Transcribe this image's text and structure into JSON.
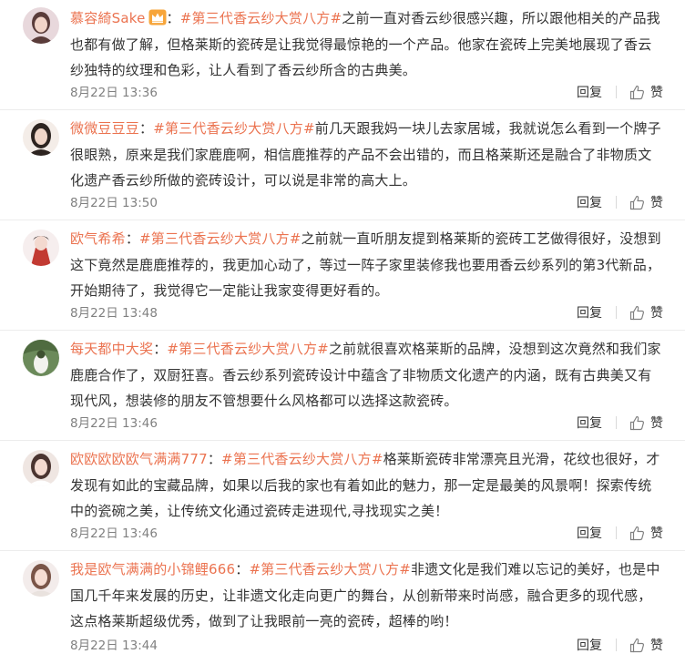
{
  "comments": [
    {
      "user": "慕容綺Sake",
      "has_badge": true,
      "tag": "#第三代香云纱大赏八方#",
      "text": "之前一直对香云纱很感兴趣，所以跟他相关的产品我也都有做了解，但格莱斯的瓷砖是让我觉得最惊艳的一个产品。他家在瓷砖上完美地展现了香云纱独特的纹理和色彩，让人看到了香云纱所含的古典美。",
      "time": "8月22日 13:36",
      "reply_label": "回复",
      "like_label": "赞",
      "avatar_colors": [
        "#e8d8dc",
        "#5a3c3a",
        "#f2d4c8"
      ]
    },
    {
      "user": "微微豆豆豆",
      "has_badge": false,
      "tag": "#第三代香云纱大赏八方#",
      "text": "前几天跟我妈一块儿去家居城，我就说怎么看到一个牌子很眼熟，原来是我们家鹿鹿啊，相信鹿推荐的产品不会出错的，而且格莱斯还是融合了非物质文化遗产香云纱所做的瓷砖设计，可以说是非常的高大上。",
      "time": "8月22日 13:50",
      "reply_label": "回复",
      "like_label": "赞",
      "avatar_colors": [
        "#f4ede8",
        "#2d2420",
        "#f0d6c8"
      ]
    },
    {
      "user": "欧气希希",
      "has_badge": false,
      "tag": "#第三代香云纱大赏八方#",
      "text": "之前就一直听朋友提到格莱斯的瓷砖工艺做得很好，没想到这下竟然是鹿鹿推荐的，我更加心动了，等过一阵子家里装修我也要用香云纱系列的第3代新品，开始期待了，我觉得它一定能让我家变得更好看的。",
      "time": "8月22日 13:48",
      "reply_label": "回复",
      "like_label": "赞",
      "avatar_colors": [
        "#f6eeee",
        "#c23a32",
        "#f3d9cf"
      ]
    },
    {
      "user": "每天都中大奖",
      "has_badge": false,
      "tag": "#第三代香云纱大赏八方#",
      "text": "之前就很喜欢格莱斯的品牌，没想到这次竟然和我们家鹿鹿合作了，双厨狂喜。香云纱系列瓷砖设计中蕴含了非物质文化遗产的内涵，既有古典美又有现代风，想装修的朋友不管想要什么风格都可以选择这款瓷砖。",
      "time": "8月22日 13:46",
      "reply_label": "回复",
      "like_label": "赞",
      "avatar_colors": [
        "#6b8a5a",
        "#f2f2ee",
        "#3e5030"
      ]
    },
    {
      "user": "欧欧欧欧欧气满满777",
      "has_badge": false,
      "tag": "#第三代香云纱大赏八方#",
      "text": "格莱斯瓷砖非常漂亮且光滑，花纹也很好，才发现有如此的宝藏品牌，如果以后我的家也有着如此的魅力，那一定是最美的风景啊！探索传统中的瓷碗之美，让传统文化通过瓷砖走进现代,寻找现实之美！",
      "time": "8月22日 13:46",
      "reply_label": "回复",
      "like_label": "赞",
      "avatar_colors": [
        "#efe6e2",
        "#4a3430",
        "#f4dad0"
      ]
    },
    {
      "user": "我是欧气满满的小锦鲤666",
      "has_badge": false,
      "tag": "#第三代香云纱大赏八方#",
      "text": "非遗文化是我们难以忘记的美好，也是中国几千年来发展的历史，让非遗文化走向更广的舞台，从创新带来时尚感，融合更多的现代感，这点格莱斯超级优秀，做到了让我眼前一亮的瓷砖，超棒的哟！",
      "time": "8月22日 13:44",
      "reply_label": "回复",
      "like_label": "赞",
      "avatar_colors": [
        "#f3eceb",
        "#7a5548",
        "#f6ddd3"
      ]
    }
  ]
}
